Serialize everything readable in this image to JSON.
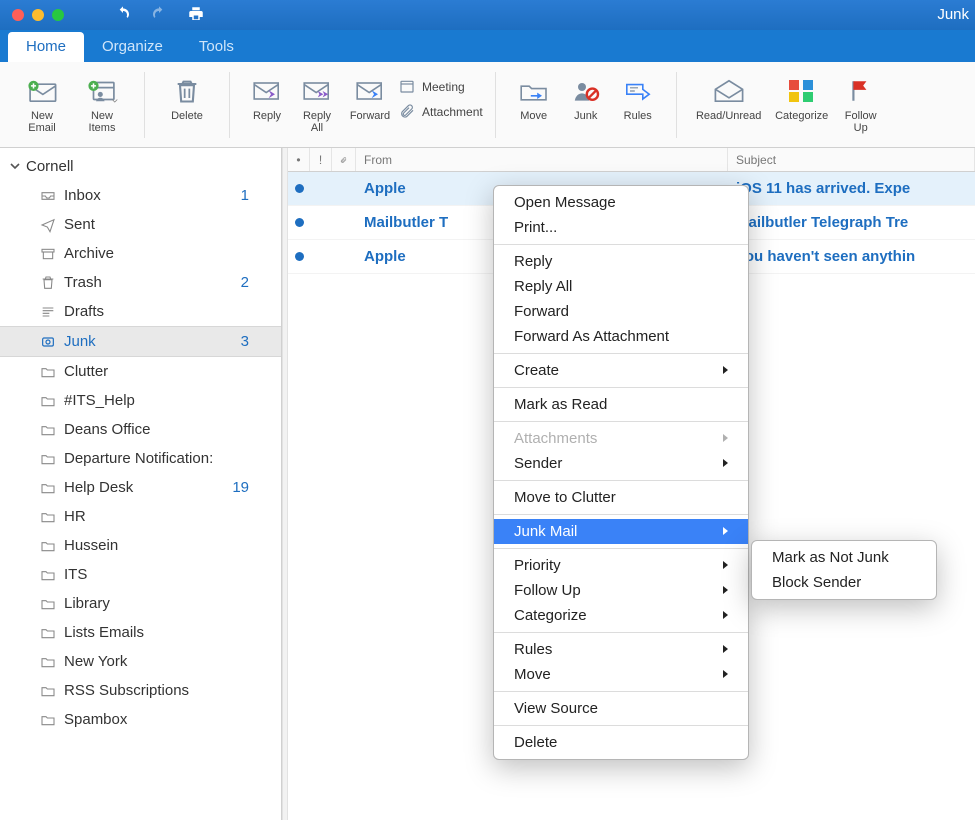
{
  "window": {
    "title": "Junk"
  },
  "titlebar_icons": {
    "undo": "undo-icon",
    "redo": "redo-icon",
    "print": "print-icon"
  },
  "tabs": [
    {
      "label": "Home",
      "active": true
    },
    {
      "label": "Organize",
      "active": false
    },
    {
      "label": "Tools",
      "active": false
    }
  ],
  "ribbon": {
    "new_email": "New\nEmail",
    "new_items": "New\nItems",
    "delete": "Delete",
    "reply": "Reply",
    "reply_all": "Reply\nAll",
    "forward": "Forward",
    "meeting": "Meeting",
    "attachment": "Attachment",
    "move": "Move",
    "junk": "Junk",
    "rules": "Rules",
    "read_unread": "Read/Unread",
    "categorize": "Categorize",
    "follow_up": "Follow\nUp"
  },
  "account": {
    "name": "Cornell"
  },
  "folders": [
    {
      "icon": "inbox",
      "label": "Inbox",
      "count": "1"
    },
    {
      "icon": "sent",
      "label": "Sent"
    },
    {
      "icon": "archive",
      "label": "Archive"
    },
    {
      "icon": "trash",
      "label": "Trash",
      "count": "2"
    },
    {
      "icon": "drafts",
      "label": "Drafts"
    },
    {
      "icon": "junk",
      "label": "Junk",
      "count": "3",
      "selected": true
    },
    {
      "icon": "folder",
      "label": "Clutter"
    },
    {
      "icon": "folder",
      "label": "#ITS_Help"
    },
    {
      "icon": "folder",
      "label": "Deans Office"
    },
    {
      "icon": "folder",
      "label": "Departure Notification:"
    },
    {
      "icon": "folder",
      "label": "Help Desk",
      "count": "19"
    },
    {
      "icon": "folder",
      "label": "HR"
    },
    {
      "icon": "folder",
      "label": "Hussein"
    },
    {
      "icon": "folder",
      "label": "ITS"
    },
    {
      "icon": "folder",
      "label": "Library"
    },
    {
      "icon": "folder",
      "label": "Lists Emails"
    },
    {
      "icon": "folder",
      "label": "New York"
    },
    {
      "icon": "folder",
      "label": "RSS Subscriptions"
    },
    {
      "icon": "folder",
      "label": "Spambox"
    }
  ],
  "listhead": {
    "from": "From",
    "subject": "Subject"
  },
  "messages": [
    {
      "unread": true,
      "selected": true,
      "from": "Apple",
      "subject": "iOS 11 has arrived. Expe"
    },
    {
      "unread": true,
      "from": "Mailbutler T",
      "subject": "Mailbutler Telegraph Tre"
    },
    {
      "unread": true,
      "from": "Apple",
      "subject": "You haven't seen anythin"
    }
  ],
  "context_menu": {
    "groups": [
      [
        {
          "label": "Open Message"
        },
        {
          "label": "Print..."
        }
      ],
      [
        {
          "label": "Reply"
        },
        {
          "label": "Reply All"
        },
        {
          "label": "Forward"
        },
        {
          "label": "Forward As Attachment"
        }
      ],
      [
        {
          "label": "Create",
          "submenu": true
        }
      ],
      [
        {
          "label": "Mark as Read"
        }
      ],
      [
        {
          "label": "Attachments",
          "submenu": true,
          "disabled": true
        },
        {
          "label": "Sender",
          "submenu": true
        }
      ],
      [
        {
          "label": "Move to Clutter"
        }
      ],
      [
        {
          "label": "Junk Mail",
          "submenu": true,
          "active": true
        }
      ],
      [
        {
          "label": "Priority",
          "submenu": true
        },
        {
          "label": "Follow Up",
          "submenu": true
        },
        {
          "label": "Categorize",
          "submenu": true
        }
      ],
      [
        {
          "label": "Rules",
          "submenu": true
        },
        {
          "label": "Move",
          "submenu": true
        }
      ],
      [
        {
          "label": "View Source"
        }
      ],
      [
        {
          "label": "Delete"
        }
      ]
    ]
  },
  "submenu": {
    "items": [
      {
        "label": "Mark as Not Junk"
      },
      {
        "label": "Block Sender"
      }
    ]
  },
  "colors": {
    "accent": "#1e6ec0",
    "highlight": "#3a82f7"
  }
}
